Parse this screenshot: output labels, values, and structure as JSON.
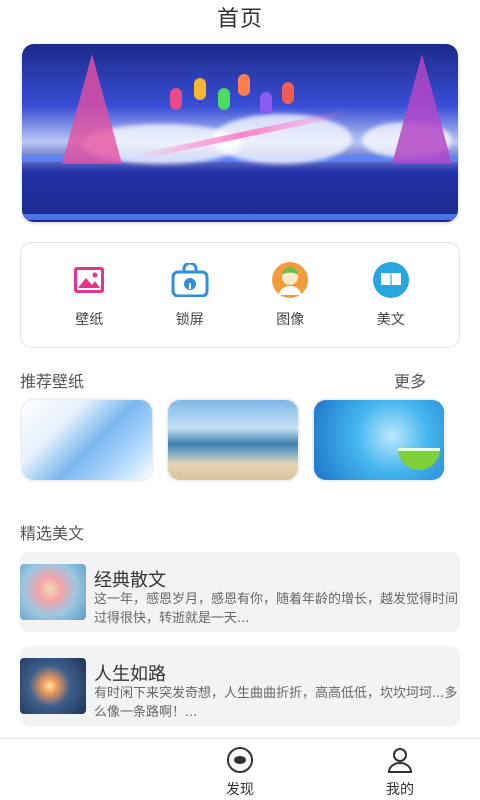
{
  "header": {
    "title": "首页"
  },
  "categories": [
    {
      "label": "壁纸",
      "icon": "image-icon",
      "color": "#e8338c"
    },
    {
      "label": "锁屏",
      "icon": "lock-screen-icon",
      "color": "#2f8fe0"
    },
    {
      "label": "图像",
      "icon": "avatar-icon",
      "color": "#f39b3a"
    },
    {
      "label": "美文",
      "icon": "book-icon",
      "color": "#27a6e0"
    }
  ],
  "wallpapers": {
    "title": "推荐壁纸",
    "more": "更多"
  },
  "articles_section": {
    "title": "精选美文",
    "items": [
      {
        "title": "经典散文",
        "desc": "这一年，感恩岁月，感恩有你，随着年龄的增长，越发觉得时间过得很快，转逝就是一天..."
      },
      {
        "title": "人生如路",
        "desc": "有时闲下来突发奇想，人生曲曲折折，高高低低，坎坎坷坷...多么像一条路啊！..."
      }
    ]
  },
  "bottom_nav": [
    {
      "label": "发现",
      "icon": "discover-icon"
    },
    {
      "label": "我的",
      "icon": "profile-icon"
    }
  ]
}
